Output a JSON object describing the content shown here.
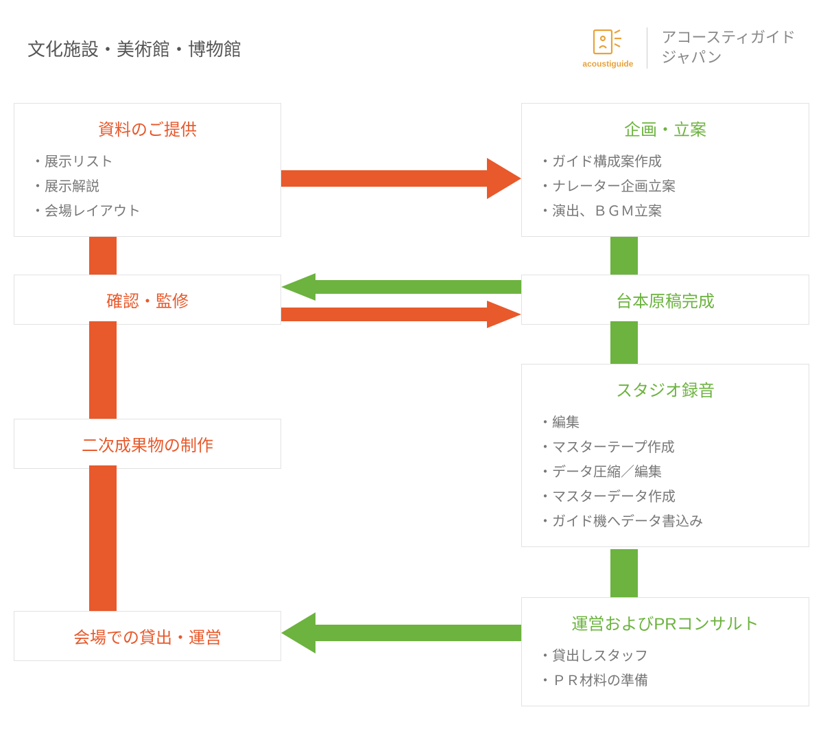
{
  "header": {
    "left_title": "文化施設・美術館・博物館",
    "logo_label": "acoustiguide",
    "company_line1": "アコースティガイド",
    "company_line2": "ジャパン"
  },
  "colors": {
    "orange": "#e8592b",
    "green": "#6cb33f"
  },
  "left_boxes": {
    "b1": {
      "title": "資料のご提供",
      "items": [
        "展示リスト",
        "展示解説",
        "会場レイアウト"
      ]
    },
    "b2": {
      "title": "確認・監修"
    },
    "b3": {
      "title": "二次成果物の制作"
    },
    "b4": {
      "title": "会場での貸出・運営"
    }
  },
  "right_boxes": {
    "b1": {
      "title": "企画・立案",
      "items": [
        "ガイド構成案作成",
        "ナレーター企画立案",
        "演出、ＢＧＭ立案"
      ]
    },
    "b2": {
      "title": "台本原稿完成"
    },
    "b3": {
      "title": "スタジオ録音",
      "items": [
        "編集",
        "マスターテープ作成",
        "データ圧縮／編集",
        "マスターデータ作成",
        "ガイド機へデータ書込み"
      ]
    },
    "b4": {
      "title": "運営およびPRコンサルト",
      "items": [
        "貸出しスタッフ",
        "ＰＲ材料の準備"
      ]
    }
  }
}
